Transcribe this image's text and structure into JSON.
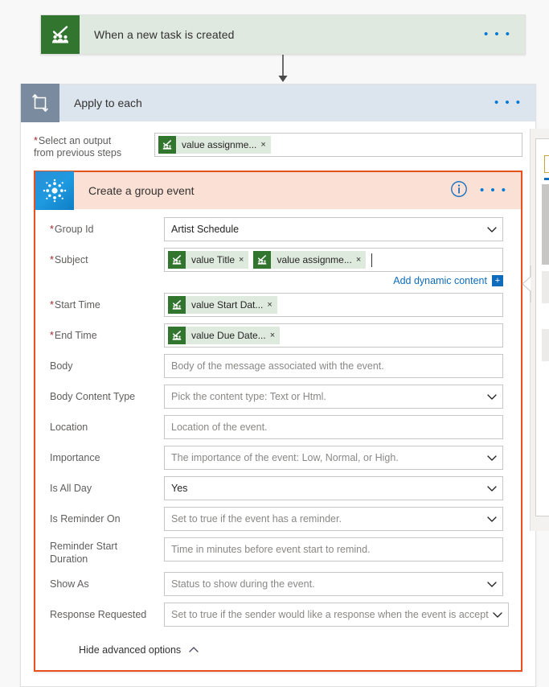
{
  "trigger": {
    "title": "When a new task is created",
    "icon": "planner-icon",
    "more_label": "• • •"
  },
  "loop": {
    "title": "Apply to each",
    "icon": "loop-icon",
    "more_label": "• • •",
    "select_output": {
      "label_line1": "Select an output",
      "label_line2": "from previous steps",
      "required": true,
      "tokens": [
        {
          "text": "value assignme...",
          "remove": "×",
          "icon": "planner-token-icon"
        }
      ]
    }
  },
  "action": {
    "title": "Create a group event",
    "icon": "office365-groups-icon",
    "info_label": "i",
    "more_label": "• • •",
    "selected_border_color": "#e8511c",
    "header_bg": "#fbe0d5",
    "fields": [
      {
        "label": "Group Id",
        "required": true,
        "type": "dropdown",
        "value": "Artist Schedule",
        "is_placeholder": false
      },
      {
        "label": "Subject",
        "required": true,
        "type": "tokens",
        "tokens": [
          {
            "text": "value Title",
            "remove": "×"
          },
          {
            "text": "value assignme...",
            "remove": "×"
          }
        ]
      },
      {
        "label": "Start Time",
        "required": true,
        "type": "tokens",
        "tokens": [
          {
            "text": "value Start Dat...",
            "remove": "×"
          }
        ]
      },
      {
        "label": "End Time",
        "required": true,
        "type": "tokens",
        "tokens": [
          {
            "text": "value Due Date...",
            "remove": "×"
          }
        ]
      },
      {
        "label": "Body",
        "required": false,
        "type": "text",
        "value": "Body of the message associated with the event.",
        "is_placeholder": true
      },
      {
        "label": "Body Content Type",
        "required": false,
        "type": "dropdown",
        "value": "Pick the content type: Text or Html.",
        "is_placeholder": true
      },
      {
        "label": "Location",
        "required": false,
        "type": "text",
        "value": "Location of the event.",
        "is_placeholder": true
      },
      {
        "label": "Importance",
        "required": false,
        "type": "dropdown",
        "value": "The importance of the event: Low, Normal, or High.",
        "is_placeholder": true
      },
      {
        "label": "Is All Day",
        "required": false,
        "type": "dropdown",
        "value": "Yes",
        "is_placeholder": false
      },
      {
        "label": "Is Reminder On",
        "required": false,
        "type": "dropdown",
        "value": "Set to true if the event has a reminder.",
        "is_placeholder": true
      },
      {
        "label": "Reminder Start Duration",
        "required": false,
        "type": "text",
        "value": "Time in minutes before event start to remind.",
        "is_placeholder": true,
        "two_line": true
      },
      {
        "label": "Show As",
        "required": false,
        "type": "dropdown",
        "value": "Status to show during the event.",
        "is_placeholder": true
      },
      {
        "label": "Response Requested",
        "required": false,
        "type": "dropdown",
        "value": "Set to true if the sender would like a response when the event is accept",
        "is_placeholder": true
      }
    ],
    "dynamic_content": {
      "link_label": "Add dynamic content",
      "plus_label": "+"
    },
    "advanced_options": {
      "label": "Hide advanced options",
      "chevron": "chevron-up-icon"
    }
  }
}
